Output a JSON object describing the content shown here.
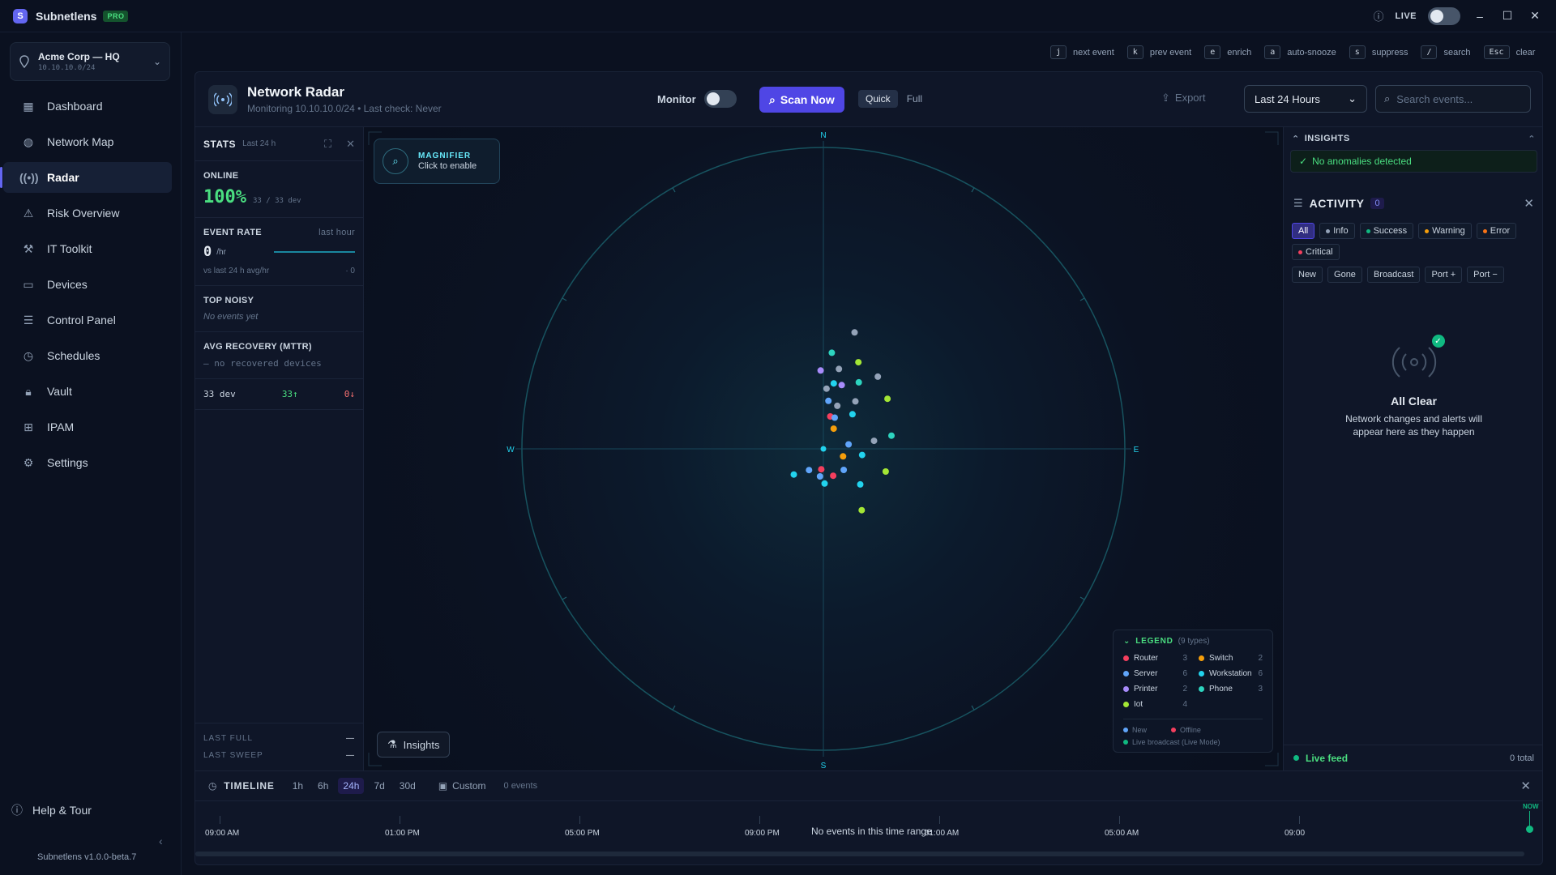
{
  "app": {
    "logo_letter": "S",
    "title": "Subnetlens",
    "badge": "PRO",
    "live_label": "LIVE"
  },
  "workspace": {
    "name": "Acme Corp — HQ",
    "subnet": "10.10.10.0/24"
  },
  "nav": {
    "items": [
      {
        "label": "Dashboard",
        "icon": "dashboard-icon"
      },
      {
        "label": "Network Map",
        "icon": "globe-icon"
      },
      {
        "label": "Radar",
        "icon": "radar-icon",
        "active": true
      },
      {
        "label": "Risk Overview",
        "icon": "warning-icon"
      },
      {
        "label": "IT Toolkit",
        "icon": "toolkit-icon"
      },
      {
        "label": "Devices",
        "icon": "monitor-icon"
      },
      {
        "label": "Control Panel",
        "icon": "sliders-icon"
      },
      {
        "label": "Schedules",
        "icon": "clock-icon"
      },
      {
        "label": "Vault",
        "icon": "lock-icon"
      },
      {
        "label": "IPAM",
        "icon": "grid-icon"
      },
      {
        "label": "Settings",
        "icon": "gear-icon"
      }
    ],
    "help": "Help & Tour",
    "version": "Subnetlens v1.0.0-beta.7"
  },
  "shortcuts": [
    {
      "key": "j",
      "label": "next event"
    },
    {
      "key": "k",
      "label": "prev event"
    },
    {
      "key": "e",
      "label": "enrich"
    },
    {
      "key": "a",
      "label": "auto-snooze"
    },
    {
      "key": "s",
      "label": "suppress"
    },
    {
      "key": "/",
      "label": "search"
    },
    {
      "key": "Esc",
      "label": "clear"
    }
  ],
  "header": {
    "title": "Network Radar",
    "subtitle": "Monitoring 10.10.10.0/24 • Last check: Never",
    "monitor_label": "Monitor",
    "scan_label": "Scan Now",
    "mode_quick": "Quick",
    "mode_full": "Full",
    "export_label": "Export",
    "range_value": "Last 24 Hours",
    "search_placeholder": "Search events..."
  },
  "stats": {
    "title": "STATS",
    "period": "Last 24 h",
    "online_label": "ONLINE",
    "online_pct": "100%",
    "online_count": "33 / 33 dev",
    "event_rate_label": "EVENT RATE",
    "event_rate_period": "last hour",
    "event_rate_value": "0",
    "event_rate_unit": "/hr",
    "event_rate_compare": "vs last 24 h avg/hr",
    "event_rate_delta": "· 0",
    "top_noisy_label": "TOP NOISY",
    "top_noisy_value": "No events yet",
    "mttr_label": "AVG RECOVERY (MTTR)",
    "mttr_value": "— no recovered devices",
    "dev_total": "33 dev",
    "dev_up": "33↑",
    "dev_down": "0↓",
    "last_full_label": "LAST FULL",
    "last_full_value": "—",
    "last_sweep_label": "LAST SWEEP",
    "last_sweep_value": "—"
  },
  "radar": {
    "compass": {
      "n": "N",
      "s": "S",
      "e": "E",
      "w": "W"
    },
    "magnifier_title": "MAGNIFIER",
    "magnifier_sub": "Click to enable",
    "insights_button": "Insights",
    "type_colors": {
      "router": "#f43f5e",
      "server": "#60a5fa",
      "printer": "#a78bfa",
      "iot": "#a3e635",
      "switch": "#f59e0b",
      "workstation": "#22d3ee",
      "phone": "#2dd4bf",
      "unknown": "#94a3b8"
    },
    "devices": [
      {
        "type": "unknown",
        "r": 0.4,
        "angle": 15
      },
      {
        "type": "phone",
        "r": 0.32,
        "angle": 5
      },
      {
        "type": "iot",
        "r": 0.31,
        "angle": 22
      },
      {
        "type": "unknown",
        "r": 0.27,
        "angle": 11
      },
      {
        "type": "printer",
        "r": 0.26,
        "angle": -2
      },
      {
        "type": "unknown",
        "r": 0.2,
        "angle": 3
      },
      {
        "type": "workstation",
        "r": 0.22,
        "angle": 9
      },
      {
        "type": "printer",
        "r": 0.22,
        "angle": 16
      },
      {
        "type": "phone",
        "r": 0.25,
        "angle": 28
      },
      {
        "type": "unknown",
        "r": 0.3,
        "angle": 37
      },
      {
        "type": "server",
        "r": 0.16,
        "angle": 6
      },
      {
        "type": "unknown",
        "r": 0.15,
        "angle": 18
      },
      {
        "type": "unknown",
        "r": 0.19,
        "angle": 34
      },
      {
        "type": "iot",
        "r": 0.27,
        "angle": 52
      },
      {
        "type": "router",
        "r": 0.11,
        "angle": 12
      },
      {
        "type": "server",
        "r": 0.11,
        "angle": 20
      },
      {
        "type": "workstation",
        "r": 0.15,
        "angle": 40
      },
      {
        "type": "switch",
        "r": 0.075,
        "angle": 27
      },
      {
        "type": "phone",
        "r": 0.23,
        "angle": 79
      },
      {
        "type": "server",
        "r": 0.085,
        "angle": 80
      },
      {
        "type": "unknown",
        "r": 0.17,
        "angle": 81
      },
      {
        "type": "switch",
        "r": 0.07,
        "angle": 111
      },
      {
        "type": "workstation",
        "r": 0.13,
        "angle": 99
      },
      {
        "type": "iot",
        "r": 0.22,
        "angle": 110
      },
      {
        "type": "server",
        "r": 0.097,
        "angle": 136
      },
      {
        "type": "router",
        "r": 0.095,
        "angle": 160
      },
      {
        "type": "router",
        "r": 0.068,
        "angle": 186
      },
      {
        "type": "server",
        "r": 0.092,
        "angle": 187
      },
      {
        "type": "workstation",
        "r": 0.17,
        "angle": 134
      },
      {
        "type": "server",
        "r": 0.085,
        "angle": 214
      },
      {
        "type": "workstation",
        "r": 0.115,
        "angle": 178
      },
      {
        "type": "workstation",
        "r": 0.13,
        "angle": 229
      },
      {
        "type": "iot",
        "r": 0.24,
        "angle": 148
      }
    ]
  },
  "legend": {
    "title": "LEGEND",
    "types_count": "(9 types)",
    "items": [
      {
        "label": "Router",
        "count": "3",
        "color": "#f43f5e"
      },
      {
        "label": "Switch",
        "count": "2",
        "color": "#f59e0b"
      },
      {
        "label": "Server",
        "count": "6",
        "color": "#60a5fa"
      },
      {
        "label": "Workstation",
        "count": "6",
        "color": "#22d3ee"
      },
      {
        "label": "Printer",
        "count": "2",
        "color": "#a78bfa"
      },
      {
        "label": "Phone",
        "count": "3",
        "color": "#2dd4bf"
      },
      {
        "label": "Iot",
        "count": "4",
        "color": "#a3e635"
      }
    ],
    "new_label": "New",
    "offline_label": "Offline",
    "live_broadcast_label": "Live broadcast (Live Mode)"
  },
  "insights": {
    "title": "INSIGHTS",
    "status": "No anomalies detected"
  },
  "activity": {
    "title": "ACTIVITY",
    "count": "0",
    "filters": [
      {
        "label": "All",
        "active": true
      },
      {
        "label": "Info",
        "color": "#94a3b8"
      },
      {
        "label": "Success",
        "color": "#10b981"
      },
      {
        "label": "Warning",
        "color": "#f59e0b"
      },
      {
        "label": "Error",
        "color": "#f97316"
      },
      {
        "label": "Critical",
        "color": "#f43f5e"
      }
    ],
    "sub_filters": [
      "New",
      "Gone",
      "Broadcast",
      "Port +",
      "Port −"
    ],
    "empty_title": "All Clear",
    "empty_desc": "Network changes and alerts will appear here as they happen",
    "feed_label": "Live feed",
    "feed_total": "0 total"
  },
  "timeline": {
    "title": "TIMELINE",
    "ranges": [
      "1h",
      "6h",
      "24h",
      "7d",
      "30d"
    ],
    "active_range": "24h",
    "custom_label": "Custom",
    "events_count": "0 events",
    "now_label": "NOW",
    "empty_text": "No events in this time range",
    "tick_labels": [
      "09:00 AM",
      "01:00 PM",
      "05:00 PM",
      "09:00 PM",
      "01:00 AM",
      "05:00 AM",
      "09:00"
    ]
  }
}
